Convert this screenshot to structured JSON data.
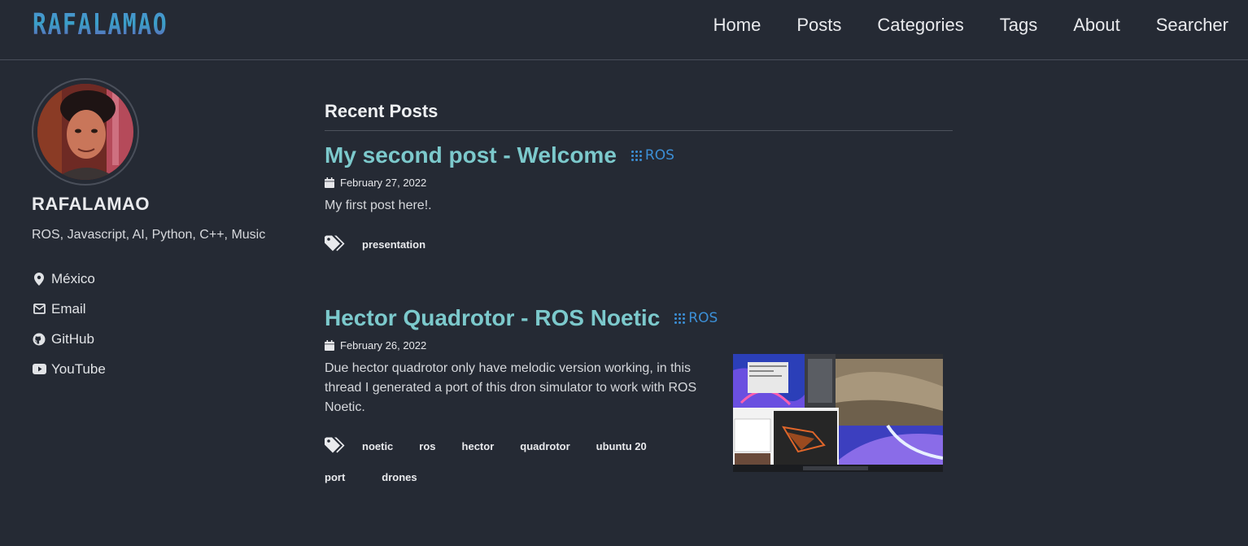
{
  "header": {
    "logo": "RAFALAMAO",
    "nav": [
      "Home",
      "Posts",
      "Categories",
      "Tags",
      "About",
      "Searcher"
    ]
  },
  "sidebar": {
    "author_name": "RAFALAMAO",
    "bio": "ROS, Javascript, AI, Python, C++, Music",
    "links": [
      {
        "icon": "location-pin-icon",
        "label": "México"
      },
      {
        "icon": "envelope-icon",
        "label": "Email"
      },
      {
        "icon": "github-icon",
        "label": "GitHub"
      },
      {
        "icon": "youtube-icon",
        "label": "YouTube"
      }
    ]
  },
  "main": {
    "section_title": "Recent Posts",
    "posts": [
      {
        "title": "My second post - Welcome",
        "category": "ROS",
        "date": "February 27, 2022",
        "excerpt": "My first post here!.",
        "tags": [
          "presentation"
        ]
      },
      {
        "title": "Hector Quadrotor - ROS Noetic",
        "category": "ROS",
        "date": "February 26, 2022",
        "excerpt": "Due hector quadrotor only have melodic version working, in this thread I generated a port of this dron simulator to work with ROS Noetic.",
        "tags": [
          "noetic",
          "ros",
          "hector",
          "quadrotor",
          "ubuntu 20",
          "port",
          "drones"
        ]
      }
    ]
  },
  "colors": {
    "background": "#252a34",
    "post_title": "#7cc9cc",
    "category": "#3c8fd6"
  }
}
